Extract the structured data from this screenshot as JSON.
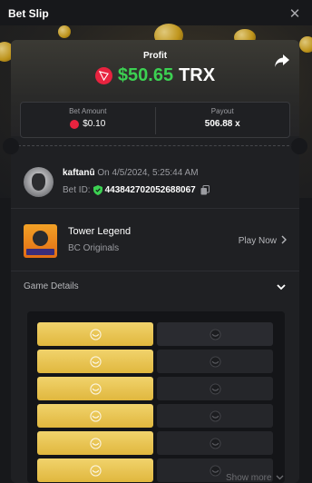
{
  "header": {
    "title": "Bet Slip",
    "close_icon": "close-icon"
  },
  "hero": {
    "profit_label": "Profit",
    "profit_amount": "$50.65",
    "profit_currency": "TRX",
    "currency_icon": "trx-icon",
    "share_icon": "share-icon",
    "profit_color": "#3cd152"
  },
  "stats": {
    "bet_amount_label": "Bet Amount",
    "bet_amount_value": "$0.10",
    "payout_label": "Payout",
    "payout_value": "506.88 x"
  },
  "user": {
    "name": "kaftanû",
    "timestamp": "On 4/5/2024, 5:25:44 AM",
    "bet_id_label": "Bet ID:",
    "bet_id": "443842702052688067"
  },
  "game": {
    "name": "Tower Legend",
    "provider": "BC Originals",
    "play_label": "Play Now"
  },
  "details": {
    "label": "Game Details"
  },
  "board": {
    "rows": [
      {
        "left": "gold",
        "right": "dark"
      },
      {
        "left": "gold",
        "right": "dark"
      },
      {
        "left": "gold",
        "right": "dark"
      },
      {
        "left": "gold",
        "right": "dark"
      },
      {
        "left": "gold",
        "right": "dark"
      },
      {
        "left": "gold",
        "right": "dark"
      }
    ],
    "gold_color": "#e6c04b",
    "dark_color": "#2a2b30"
  },
  "footer": {
    "show_more": "Show more"
  }
}
